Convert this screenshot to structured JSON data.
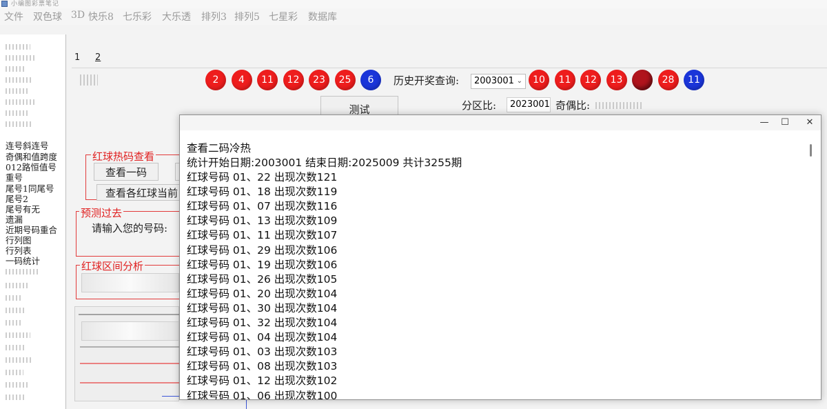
{
  "app": {
    "title": "小编图彩票笔记"
  },
  "menu": [
    "文件",
    "双色球",
    "3D",
    "快乐8",
    "七乐彩",
    "大乐透",
    "排列3",
    "排列5",
    "七星彩",
    "数据库"
  ],
  "left_list": [
    "连号斜连号",
    "奇偶和值跨度",
    "012路恒值号",
    "重号",
    "尾号1同尾号",
    "尾号2",
    "尾号有无",
    "遗漏",
    "近期号码重合",
    "行列图",
    "行列表",
    "一码统计"
  ],
  "tabs": [
    "1",
    "2"
  ],
  "balls_left": [
    {
      "n": "2",
      "color": "red"
    },
    {
      "n": "4",
      "color": "red"
    },
    {
      "n": "11",
      "color": "red"
    },
    {
      "n": "12",
      "color": "red"
    },
    {
      "n": "23",
      "color": "red"
    },
    {
      "n": "25",
      "color": "red"
    },
    {
      "n": "6",
      "color": "blue"
    }
  ],
  "history": {
    "label": "历史开奖查询:",
    "value": "2003001"
  },
  "balls_right": [
    {
      "n": "10",
      "color": "red"
    },
    {
      "n": "11",
      "color": "red"
    },
    {
      "n": "12",
      "color": "red"
    },
    {
      "n": "13",
      "color": "red"
    },
    {
      "n": "",
      "color": "dark"
    },
    {
      "n": "28",
      "color": "red"
    },
    {
      "n": "11",
      "color": "blue"
    }
  ],
  "test_button": "测试",
  "zone": {
    "label": "分区比:",
    "value": "2023001"
  },
  "odd_even": {
    "label": "奇偶比:"
  },
  "hot_group": {
    "title": "红球热码查看",
    "btn_one": "查看一码",
    "btn_all": "查看各红球当前"
  },
  "predict_group": {
    "title": "预测过去",
    "prompt": "请输入您的号码:"
  },
  "interval_group": {
    "title": "红球区间分析"
  },
  "popup": {
    "controls": {
      "minimize": "—",
      "maximize": "☐",
      "close": "✕"
    },
    "heading": "查看二码冷热",
    "summary": "统计开始日期:2003001 结束日期:2025009 共计3255期",
    "rows": [
      "红球号码 01、22 出现次数121",
      "红球号码 01、18 出现次数119",
      "红球号码 01、07 出现次数116",
      "红球号码 01、13 出现次数109",
      "红球号码 01、11 出现次数107",
      "红球号码 01、29 出现次数106",
      "红球号码 01、19 出现次数106",
      "红球号码 01、26 出现次数105",
      "红球号码 01、20 出现次数104",
      "红球号码 01、30 出现次数104",
      "红球号码 01、32 出现次数104",
      "红球号码 01、04 出现次数104",
      "红球号码 01、03 出现次数103",
      "红球号码 01、08 出现次数103",
      "红球号码 01、12 出现次数102",
      "红球号码 01、06 出现次数100"
    ]
  },
  "colors": {
    "red_ball": "#ee1d1d",
    "blue_ball": "#1a35d9",
    "group_border": "#e23a3a"
  }
}
